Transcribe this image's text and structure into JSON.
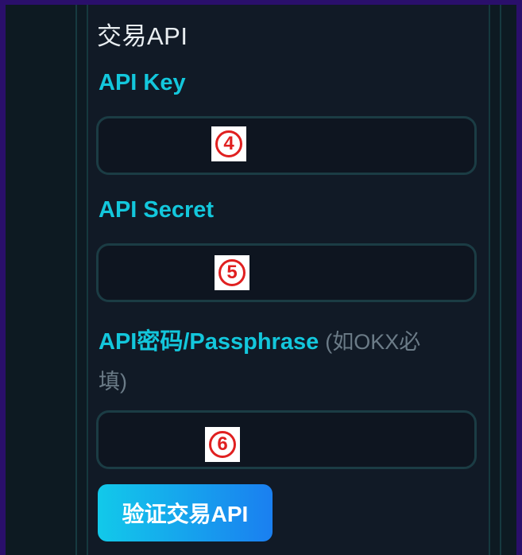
{
  "section": {
    "title": "交易API"
  },
  "fields": [
    {
      "label": "API Key",
      "value": "",
      "badge": "4"
    },
    {
      "label": "API Secret",
      "value": "",
      "badge": "5"
    },
    {
      "label": "API密码/Passphrase",
      "hint_line1": "(如OKX必",
      "hint_line2": "填)",
      "value": "",
      "badge": "6"
    }
  ],
  "button": {
    "label": "验证交易API"
  },
  "colors": {
    "accent": "#13c7dc",
    "background": "#111a26",
    "page_border": "#2a0f6b",
    "badge_red": "#e02020"
  }
}
